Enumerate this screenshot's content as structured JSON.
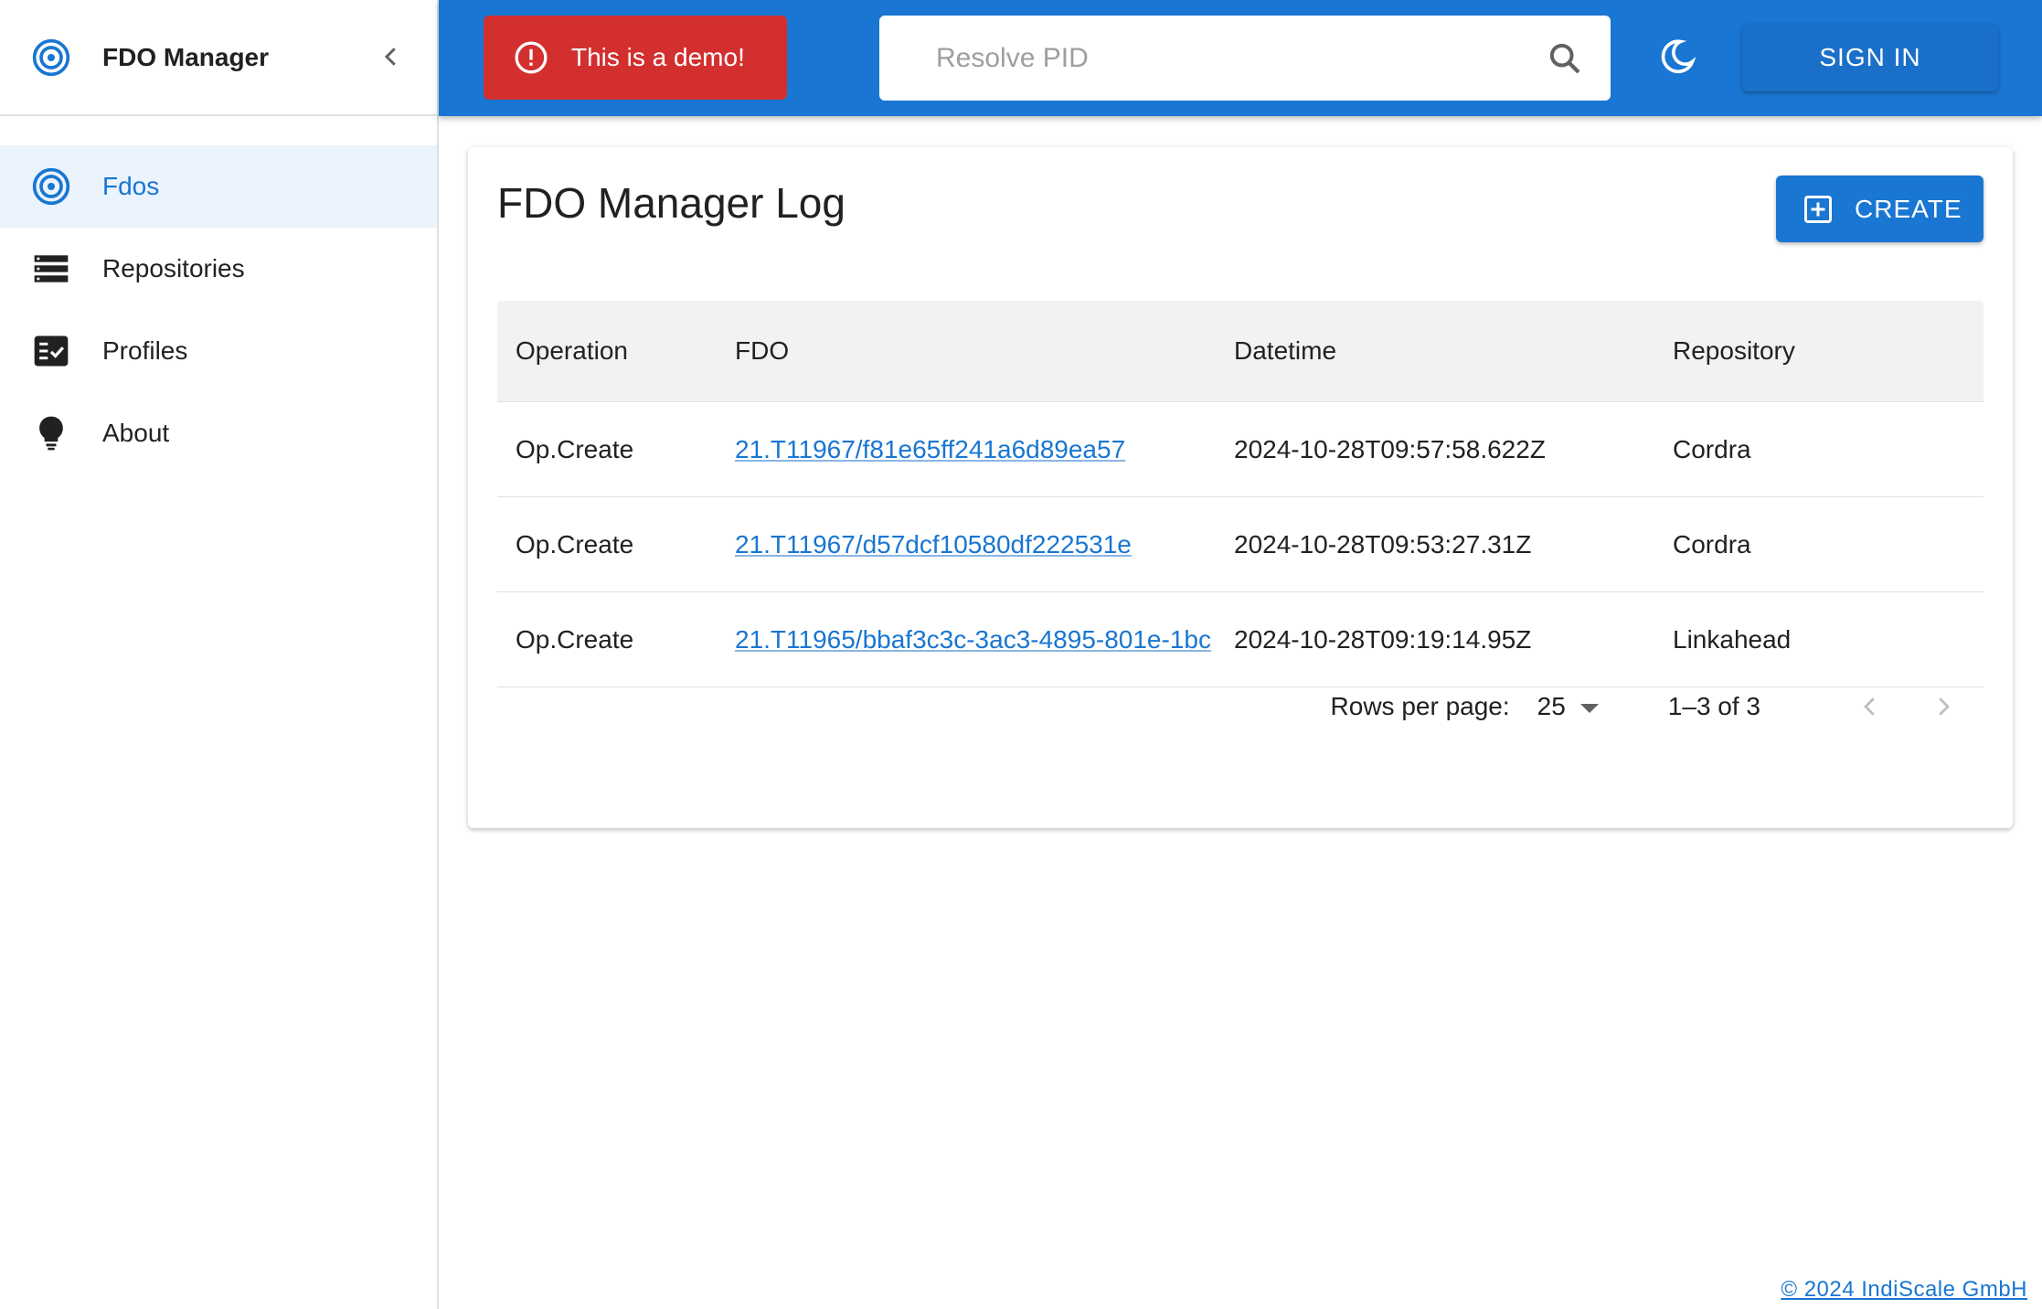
{
  "app": {
    "title": "FDO Manager"
  },
  "sidebar": {
    "items": [
      {
        "label": "Fdos",
        "icon": "target-icon",
        "active": true
      },
      {
        "label": "Repositories",
        "icon": "storage-icon",
        "active": false
      },
      {
        "label": "Profiles",
        "icon": "checklist-icon",
        "active": false
      },
      {
        "label": "About",
        "icon": "lightbulb-icon",
        "active": false
      }
    ]
  },
  "header": {
    "demo_alert": "This is a demo!",
    "search_placeholder": "Resolve PID",
    "search_value": "",
    "signin_label": "SIGN IN"
  },
  "main": {
    "title": "FDO Manager Log",
    "create_label": "CREATE",
    "table": {
      "columns": [
        "Operation",
        "FDO",
        "Datetime",
        "Repository"
      ],
      "rows": [
        {
          "operation": "Op.Create",
          "fdo": "21.T11967/f81e65ff241a6d89ea57",
          "datetime": "2024-10-28T09:57:58.622Z",
          "repository": "Cordra"
        },
        {
          "operation": "Op.Create",
          "fdo": "21.T11967/d57dcf10580df222531e",
          "datetime": "2024-10-28T09:53:27.31Z",
          "repository": "Cordra"
        },
        {
          "operation": "Op.Create",
          "fdo": "21.T11965/bbaf3c3c-3ac3-4895-801e-1bc",
          "datetime": "2024-10-28T09:19:14.95Z",
          "repository": "Linkahead"
        }
      ]
    },
    "pagination": {
      "rows_per_page_label": "Rows per page:",
      "rows_per_page": "25",
      "range": "1–3 of 3"
    }
  },
  "footer": {
    "copyright": "© 2024 IndiScale GmbH"
  },
  "colors": {
    "primary": "#1976d2",
    "demo_alert": "#d32f2f",
    "active_nav_bg": "#ebf3fc"
  }
}
